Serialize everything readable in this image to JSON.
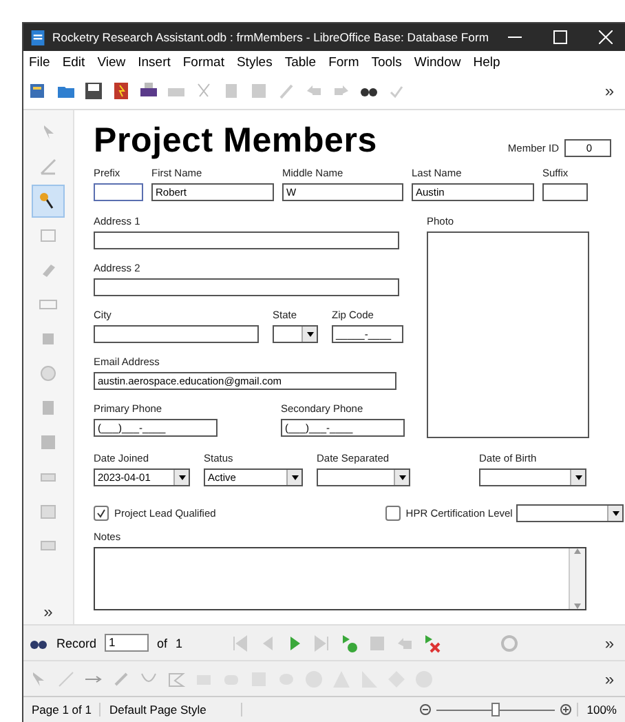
{
  "window": {
    "title": "Rocketry Research Assistant.odb : frmMembers - LibreOffice Base: Database Form"
  },
  "menu": [
    "File",
    "Edit",
    "View",
    "Insert",
    "Format",
    "Styles",
    "Table",
    "Form",
    "Tools",
    "Window",
    "Help"
  ],
  "toolbar": {
    "overflow": "»"
  },
  "form_controls_toolbar": {
    "items": [
      {
        "selected": false
      },
      {
        "selected": false
      },
      {
        "selected": true
      },
      {
        "selected": false
      },
      {
        "selected": false
      },
      {
        "selected": false
      },
      {
        "selected": false
      },
      {
        "selected": false
      },
      {
        "selected": false
      },
      {
        "selected": false
      },
      {
        "selected": false
      },
      {
        "selected": false
      },
      {
        "selected": false
      }
    ],
    "overflow": "»"
  },
  "form": {
    "title": "Project Members",
    "member_id": {
      "label": "Member ID",
      "value": "0"
    },
    "name_fields": [
      {
        "label": "Prefix"
      },
      {
        "label": "First Name",
        "value": "Robert"
      },
      {
        "label": "Middle Name",
        "value": "W"
      },
      {
        "label": "Last Name",
        "value": "Austin"
      },
      {
        "label": "Suffix"
      }
    ],
    "address_1": {
      "label": "Address 1"
    },
    "address_2": {
      "label": "Address 2"
    },
    "city": {
      "label": "City"
    },
    "state": {
      "label": "State"
    },
    "zip_code": {
      "label": "Zip Code",
      "value": "_____-____"
    },
    "email": {
      "label": "Email Address",
      "value": "austin.aerospace.education@gmail.com"
    },
    "primary_phone": {
      "label": "Primary Phone",
      "value": "(___)___-____"
    },
    "secondary_phone": {
      "label": "Secondary Phone",
      "value": "(___)___-____"
    },
    "photo": {
      "label": "Photo"
    },
    "date_joined": {
      "label": "Date Joined",
      "value": "2023-04-01"
    },
    "status": {
      "label": "Status",
      "value": "Active"
    },
    "date_separated": {
      "label": "Date Separated"
    },
    "date_of_birth": {
      "label": "Date of Birth"
    },
    "project_lead": {
      "label": "Project Lead Qualified",
      "checked": true
    },
    "hpr_certification": {
      "label": "HPR Certification Level",
      "checked": false
    },
    "notes": {
      "label": "Notes"
    }
  },
  "navigation": {
    "label": "Record",
    "record": "1",
    "of": "of",
    "total": "1",
    "overflow": "»"
  },
  "drawing_toolbar": {
    "overflow": "»"
  },
  "status_bar": {
    "page": "Page 1 of 1",
    "page_style": "Default Page Style",
    "zoom": "100%",
    "zoom_slider": {
      "level": 0.5
    }
  }
}
